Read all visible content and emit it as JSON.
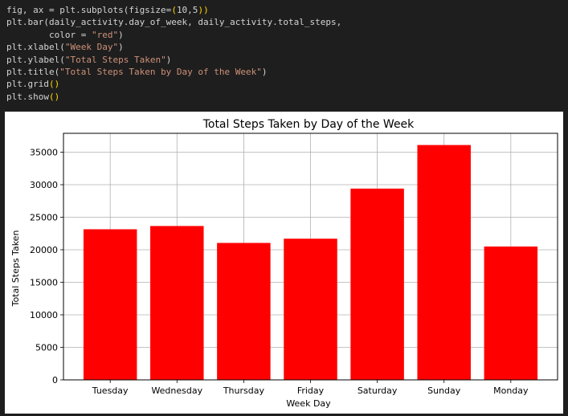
{
  "code": {
    "lines": [
      [
        {
          "t": "fig, ax = plt.subplots(figsize=",
          "c": "plain"
        },
        {
          "t": "(",
          "c": "paren"
        },
        {
          "t": "10,5",
          "c": "plain"
        },
        {
          "t": ")",
          "c": "paren"
        },
        {
          "t": ")",
          "c": "paren"
        }
      ],
      [
        {
          "t": "plt.bar(daily_activity.day_of_week, daily_activity.total_steps,",
          "c": "plain"
        }
      ],
      [
        {
          "t": "        color = ",
          "c": "plain"
        },
        {
          "t": "\"red\"",
          "c": "str"
        },
        {
          "t": ")",
          "c": "plain"
        }
      ],
      [
        {
          "t": "plt.xlabel(",
          "c": "plain"
        },
        {
          "t": "\"Week Day\"",
          "c": "str"
        },
        {
          "t": ")",
          "c": "plain"
        }
      ],
      [
        {
          "t": "plt.ylabel(",
          "c": "plain"
        },
        {
          "t": "\"Total Steps Taken\"",
          "c": "str"
        },
        {
          "t": ")",
          "c": "plain"
        }
      ],
      [
        {
          "t": "plt.title(",
          "c": "plain"
        },
        {
          "t": "\"Total Steps Taken by Day of the Week\"",
          "c": "str"
        },
        {
          "t": ")",
          "c": "plain"
        }
      ],
      [
        {
          "t": "plt.grid",
          "c": "plain"
        },
        {
          "t": "()",
          "c": "paren"
        }
      ],
      [
        {
          "t": "plt.show",
          "c": "plain"
        },
        {
          "t": "()",
          "c": "paren"
        }
      ]
    ]
  },
  "colors": {
    "code_string": "#ce9178",
    "code_paren": "#ffd700",
    "bar": "#ff0000",
    "grid": "#b0b0b0"
  },
  "chart_data": {
    "type": "bar",
    "title": "Total Steps Taken by Day of the Week",
    "xlabel": "Week Day",
    "ylabel": "Total Steps Taken",
    "categories": [
      "Tuesday",
      "Wednesday",
      "Thursday",
      "Friday",
      "Saturday",
      "Sunday",
      "Monday"
    ],
    "values": [
      23150,
      23650,
      21050,
      21700,
      29400,
      36100,
      20500
    ],
    "ylim": [
      0,
      37900
    ],
    "yticks": [
      0,
      5000,
      10000,
      15000,
      20000,
      25000,
      30000,
      35000
    ],
    "grid": true,
    "bar_color": "red"
  }
}
